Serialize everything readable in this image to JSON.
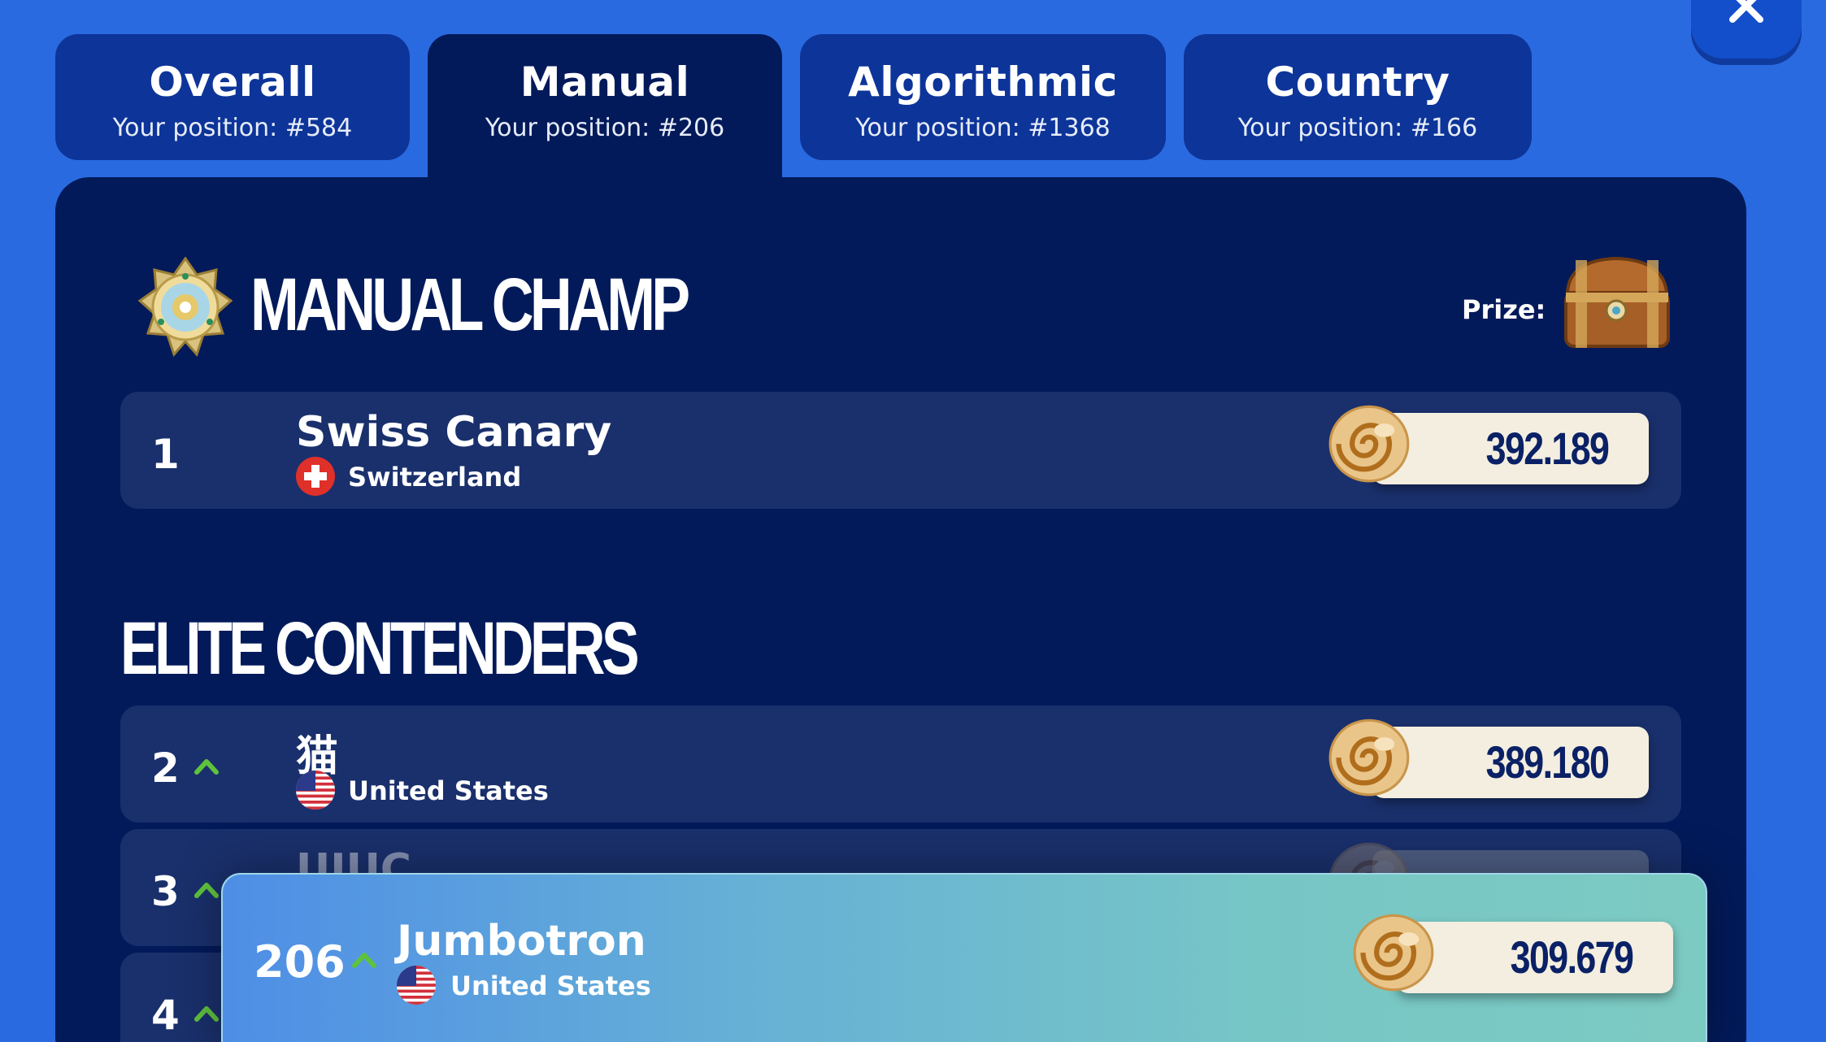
{
  "tabs": [
    {
      "label": "Overall",
      "position": "Your position: #584"
    },
    {
      "label": "Manual",
      "position": "Your position: #206"
    },
    {
      "label": "Algorithmic",
      "position": "Your position: #1368"
    },
    {
      "label": "Country",
      "position": "Your position: #166"
    }
  ],
  "active_tab": "Manual",
  "champ": {
    "title": "MANUAL CHAMP",
    "prize_label": "Prize:",
    "rank": "1",
    "name": "Swiss Canary",
    "country": "Switzerland",
    "score": "392.189"
  },
  "elite": {
    "title": "ELITE CONTENDERS",
    "rows": [
      {
        "rank": "2",
        "name": "猫",
        "country": "United States",
        "score": "389.180"
      },
      {
        "rank": "3",
        "name": "UIUC",
        "country": "",
        "score": ""
      },
      {
        "rank": "4",
        "name": "",
        "country": "",
        "score": ""
      }
    ]
  },
  "current_user": {
    "rank": "206",
    "name": "Jumbotron",
    "country": "United States",
    "score": "309.679"
  },
  "icons": {
    "close": "close-icon",
    "medal": "medal-icon",
    "chest": "treasure-chest-icon",
    "shell": "shell-icon",
    "rank_up": "chevron-up-icon",
    "flag_ch": "swiss-flag-icon",
    "flag_us": "us-flag-icon"
  },
  "colors": {
    "background": "#2a6ae0",
    "panel": "#031a5a",
    "tab": "#0d3499",
    "row": "#1a306c",
    "score_pill": "#f3eedf",
    "score_text": "#0b2166",
    "rank_up": "#5fc23d"
  }
}
